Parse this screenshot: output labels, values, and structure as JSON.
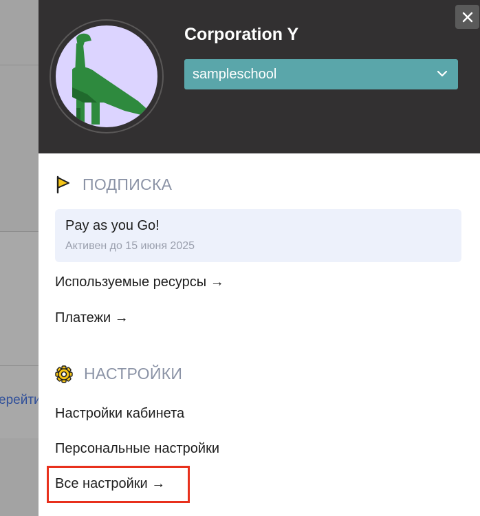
{
  "background_page": {
    "link_fragment": "ерейти"
  },
  "header": {
    "org_name": "Corporation Y",
    "school_select_value": "sampleschool",
    "close_label": "×"
  },
  "subscription": {
    "heading": "ПОДПИСКА",
    "plan_name": "Pay as you Go!",
    "plan_status": "Активен до 15 июня 2025",
    "links": [
      "Используемые ресурсы →",
      "Платежи →"
    ]
  },
  "settings": {
    "heading": "НАСТРОЙКИ",
    "links": [
      "Настройки кабинета",
      "Персональные настройки",
      "Все настройки →"
    ]
  },
  "colors": {
    "header_bg": "#323031",
    "select_bg": "#5aa6aa",
    "avatar_bg": "#dcd4ff",
    "dino": "#2e8a3e",
    "highlight_border": "#e8301c"
  }
}
